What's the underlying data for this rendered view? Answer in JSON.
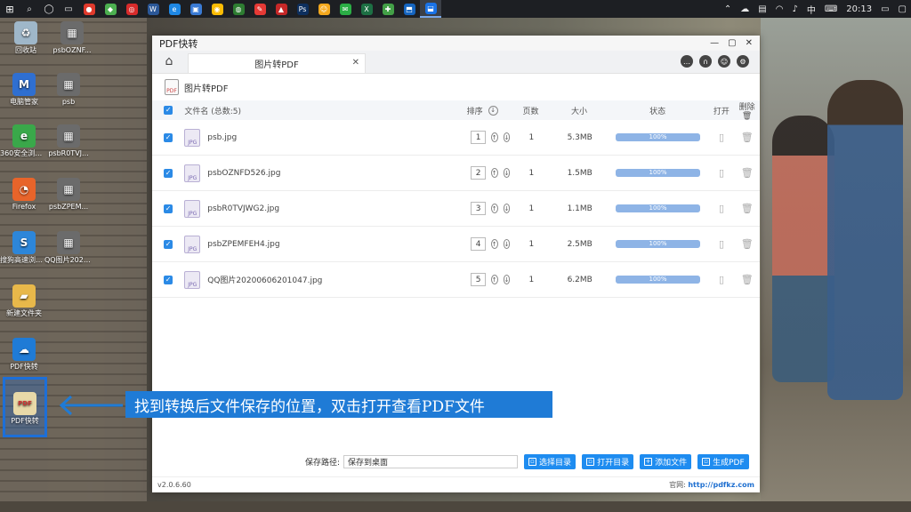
{
  "taskbar": {
    "apps": [
      {
        "name": "app-red",
        "color": "#e03a2c",
        "glyph": "●"
      },
      {
        "name": "app-green",
        "color": "#4caf50",
        "glyph": "◆"
      },
      {
        "name": "app-red2",
        "color": "#d82b2b",
        "glyph": "◎"
      },
      {
        "name": "app-word",
        "color": "#2b5797",
        "glyph": "W"
      },
      {
        "name": "app-edge",
        "color": "#1e88e5",
        "glyph": "e"
      },
      {
        "name": "app-blue",
        "color": "#3a7bd5",
        "glyph": "▣"
      },
      {
        "name": "app-chrome",
        "color": "#fbbc05",
        "glyph": "◉"
      },
      {
        "name": "app-browser",
        "color": "#2e7d32",
        "glyph": "◍"
      },
      {
        "name": "app-tool",
        "color": "#e53935",
        "glyph": "✎"
      },
      {
        "name": "app-red3",
        "color": "#c62828",
        "glyph": "▲"
      },
      {
        "name": "app-ps",
        "color": "#0d2f5e",
        "glyph": "Ps"
      },
      {
        "name": "app-yellow",
        "color": "#f4a81d",
        "glyph": "☺"
      },
      {
        "name": "app-wechat",
        "color": "#2bae45",
        "glyph": "✉"
      },
      {
        "name": "app-excel",
        "color": "#1d7044",
        "glyph": "X"
      },
      {
        "name": "app-green2",
        "color": "#43a047",
        "glyph": "✚"
      },
      {
        "name": "app-blue2",
        "color": "#1565c0",
        "glyph": "⬒"
      },
      {
        "name": "app-pdf-active",
        "color": "#1a73e8",
        "glyph": "⬓"
      }
    ],
    "lang": "中",
    "time": "20:13"
  },
  "desktop": {
    "icons": [
      {
        "label": "回收站",
        "color": "#9fb7c9",
        "glyph": "♻"
      },
      {
        "label": "psbOZNF...",
        "color": "#6b6b6b",
        "glyph": "▦"
      },
      {
        "label": "电脑管家",
        "color": "#2f6fd1",
        "glyph": "M"
      },
      {
        "label": "psb",
        "color": "#6b6b6b",
        "glyph": "▦"
      },
      {
        "label": "360安全浏览器",
        "color": "#3aa84a",
        "glyph": "e"
      },
      {
        "label": "psbR0TVJ...",
        "color": "#6b6b6b",
        "glyph": "▦"
      },
      {
        "label": "Firefox",
        "color": "#e8642a",
        "glyph": "◔"
      },
      {
        "label": "psbZPEM...",
        "color": "#6b6b6b",
        "glyph": "▦"
      },
      {
        "label": "搜狗高速浏览器",
        "color": "#2d86d9",
        "glyph": "S"
      },
      {
        "label": "QQ图片20200606...",
        "color": "#6b6b6b",
        "glyph": "▦"
      },
      {
        "label": "新建文件夹",
        "color": "#e8b84a",
        "glyph": "▰"
      },
      {
        "label": "PDF快转",
        "color": "#1f7bd6",
        "glyph": "☁"
      },
      {
        "label": "PDF快转",
        "color": "#e8d9a8",
        "glyph": "PDF"
      }
    ]
  },
  "annotation": {
    "text": "找到转换后文件保存的位置，双击打开查看PDF文件"
  },
  "window": {
    "title": "PDF快转",
    "tab_label": "图片转PDF",
    "section_title": "图片转PDF",
    "headers": {
      "filename": "文件名 (总数:5)",
      "order": "排序",
      "pages": "页数",
      "size": "大小",
      "status": "状态",
      "open": "打开",
      "delete": "删除"
    },
    "rows": [
      {
        "name": "psb.jpg",
        "order": "1",
        "pages": "1",
        "size": "5.3MB",
        "progress": "100%"
      },
      {
        "name": "psbOZNFD526.jpg",
        "order": "2",
        "pages": "1",
        "size": "1.5MB",
        "progress": "100%"
      },
      {
        "name": "psbR0TVJWG2.jpg",
        "order": "3",
        "pages": "1",
        "size": "1.1MB",
        "progress": "100%"
      },
      {
        "name": "psbZPEMFEH4.jpg",
        "order": "4",
        "pages": "1",
        "size": "2.5MB",
        "progress": "100%"
      },
      {
        "name": "QQ图片20200606201047.jpg",
        "order": "5",
        "pages": "1",
        "size": "6.2MB",
        "progress": "100%"
      }
    ],
    "footer": {
      "save_path_label": "保存路径:",
      "save_path_value": "保存到桌面",
      "choose_dir": "选择目录",
      "open_dir": "打开目录",
      "add_file": "添加文件",
      "generate_pdf": "生成PDF"
    },
    "version": "v2.0.6.60",
    "website_label": "官网:",
    "website": "http://pdfkz.com"
  },
  "colors": {
    "accent": "#1e8cf0",
    "banner": "#1f7bd6",
    "progress_fill": "#8eb4e6"
  }
}
